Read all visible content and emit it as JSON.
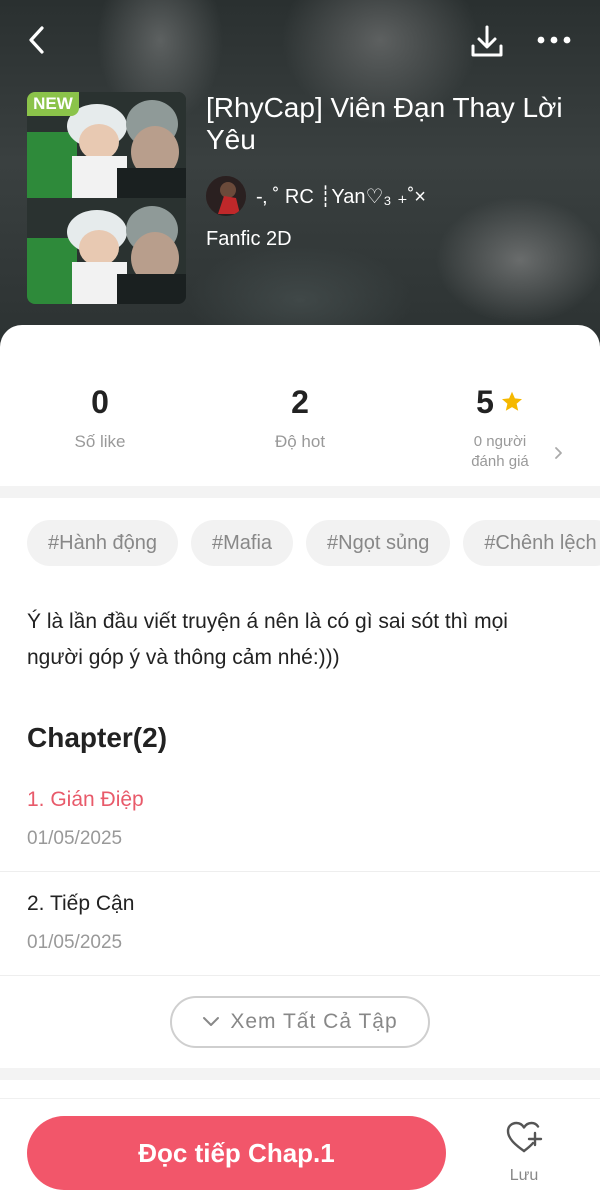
{
  "header": {
    "new_badge": "NEW",
    "title": "[RhyCap] Viên Đạn Thay Lời Yêu",
    "author": "-‚ ˚ RC ┊Yan♡₃ ₊˚×",
    "genre": "Fanfic 2D"
  },
  "stats": {
    "likes": {
      "value": "0",
      "label": "Số like"
    },
    "hot": {
      "value": "2",
      "label": "Độ hot"
    },
    "rating": {
      "value": "5",
      "label_line1": "0 người",
      "label_line2": "đánh giá"
    }
  },
  "tags": [
    "#Hành động",
    "#Mafia",
    "#Ngọt sủng",
    "#Chênh lệch"
  ],
  "description": "Ý là lần đầu viết truyện á nên là có gì sai sót thì mọi người góp ý và thông cảm nhé:)))",
  "chapters": {
    "heading": "Chapter(2)",
    "items": [
      {
        "title": "1. Gián Điệp",
        "date": "01/05/2025"
      },
      {
        "title": "2. Tiếp Cận",
        "date": "01/05/2025"
      }
    ],
    "view_all": "Xem Tất Cả Tập"
  },
  "bottom": {
    "read_button": "Đọc tiếp Chap.1",
    "save_label": "Lưu"
  },
  "colors": {
    "accent": "#f2566a",
    "active_chapter": "#e85a6a",
    "new_badge": "#8bc34a",
    "star": "#f5b800"
  },
  "icons": {
    "back": "chevron-left-icon",
    "download": "download-icon",
    "more": "more-horizontal-icon",
    "star": "star-icon",
    "chevron": "chevron-right-icon",
    "expand": "chevron-down-icon",
    "save": "heart-plus-icon"
  }
}
